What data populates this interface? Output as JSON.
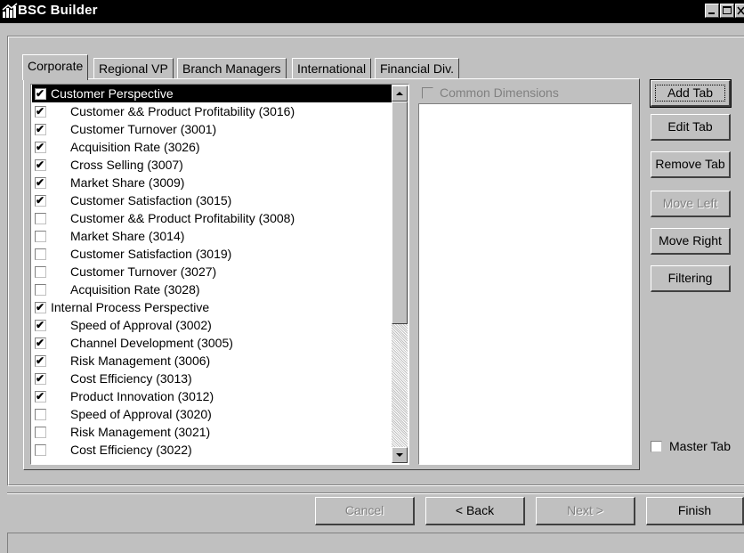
{
  "window": {
    "title": "BSC Builder"
  },
  "tabs": [
    {
      "label": "Corporate",
      "active": true
    },
    {
      "label": "Regional VP",
      "active": false
    },
    {
      "label": "Branch Managers",
      "active": false
    },
    {
      "label": "International",
      "active": false
    },
    {
      "label": "Financial Div.",
      "active": false
    }
  ],
  "measures_list": {
    "items": [
      {
        "label": "Customer Perspective",
        "checked": true,
        "group": true,
        "selected": true
      },
      {
        "label": "Customer && Product Profitability (3016)",
        "checked": true
      },
      {
        "label": "Customer Turnover (3001)",
        "checked": true
      },
      {
        "label": "Acquisition Rate (3026)",
        "checked": true
      },
      {
        "label": "Cross Selling (3007)",
        "checked": true
      },
      {
        "label": "Market Share (3009)",
        "checked": true
      },
      {
        "label": "Customer Satisfaction (3015)",
        "checked": true
      },
      {
        "label": "Customer && Product Profitability  (3008)",
        "checked": false
      },
      {
        "label": "Market Share  (3014)",
        "checked": false
      },
      {
        "label": "Customer Satisfaction  (3019)",
        "checked": false
      },
      {
        "label": "Customer Turnover (3027)",
        "checked": false
      },
      {
        "label": "Acquisition Rate (3028)",
        "checked": false
      },
      {
        "label": "Internal Process Perspective",
        "checked": true,
        "group": true
      },
      {
        "label": "Speed of Approval (3002)",
        "checked": true
      },
      {
        "label": "Channel Development (3005)",
        "checked": true
      },
      {
        "label": "Risk Management (3006)",
        "checked": true
      },
      {
        "label": "Cost Efficiency (3013)",
        "checked": true
      },
      {
        "label": "Product Innovation (3012)",
        "checked": true
      },
      {
        "label": "Speed of Approval (3020)",
        "checked": false
      },
      {
        "label": "Risk Management (3021)",
        "checked": false
      },
      {
        "label": "Cost Efficiency (3022)",
        "checked": false
      }
    ]
  },
  "common_dimensions": {
    "label": "Common Dimensions",
    "checked": false,
    "enabled": false
  },
  "side_buttons": {
    "add_tab": "Add Tab",
    "edit_tab": "Edit Tab",
    "remove_tab": "Remove Tab",
    "move_left": "Move Left",
    "move_right": "Move Right",
    "filtering": "Filtering"
  },
  "master_tab": {
    "label": "Master Tab",
    "checked": false
  },
  "footer_buttons": {
    "cancel": "Cancel",
    "back": "< Back",
    "next": "Next >",
    "finish": "Finish"
  },
  "icons": [
    "app-icon",
    "minimize-icon",
    "maximize-icon",
    "close-icon",
    "scroll-up-icon",
    "scroll-down-icon",
    "checkmark-icon"
  ],
  "colors": {
    "titlebar": "#000000",
    "face": "#c0c0c0",
    "selection": "#000000",
    "disabled_text": "#808080"
  }
}
